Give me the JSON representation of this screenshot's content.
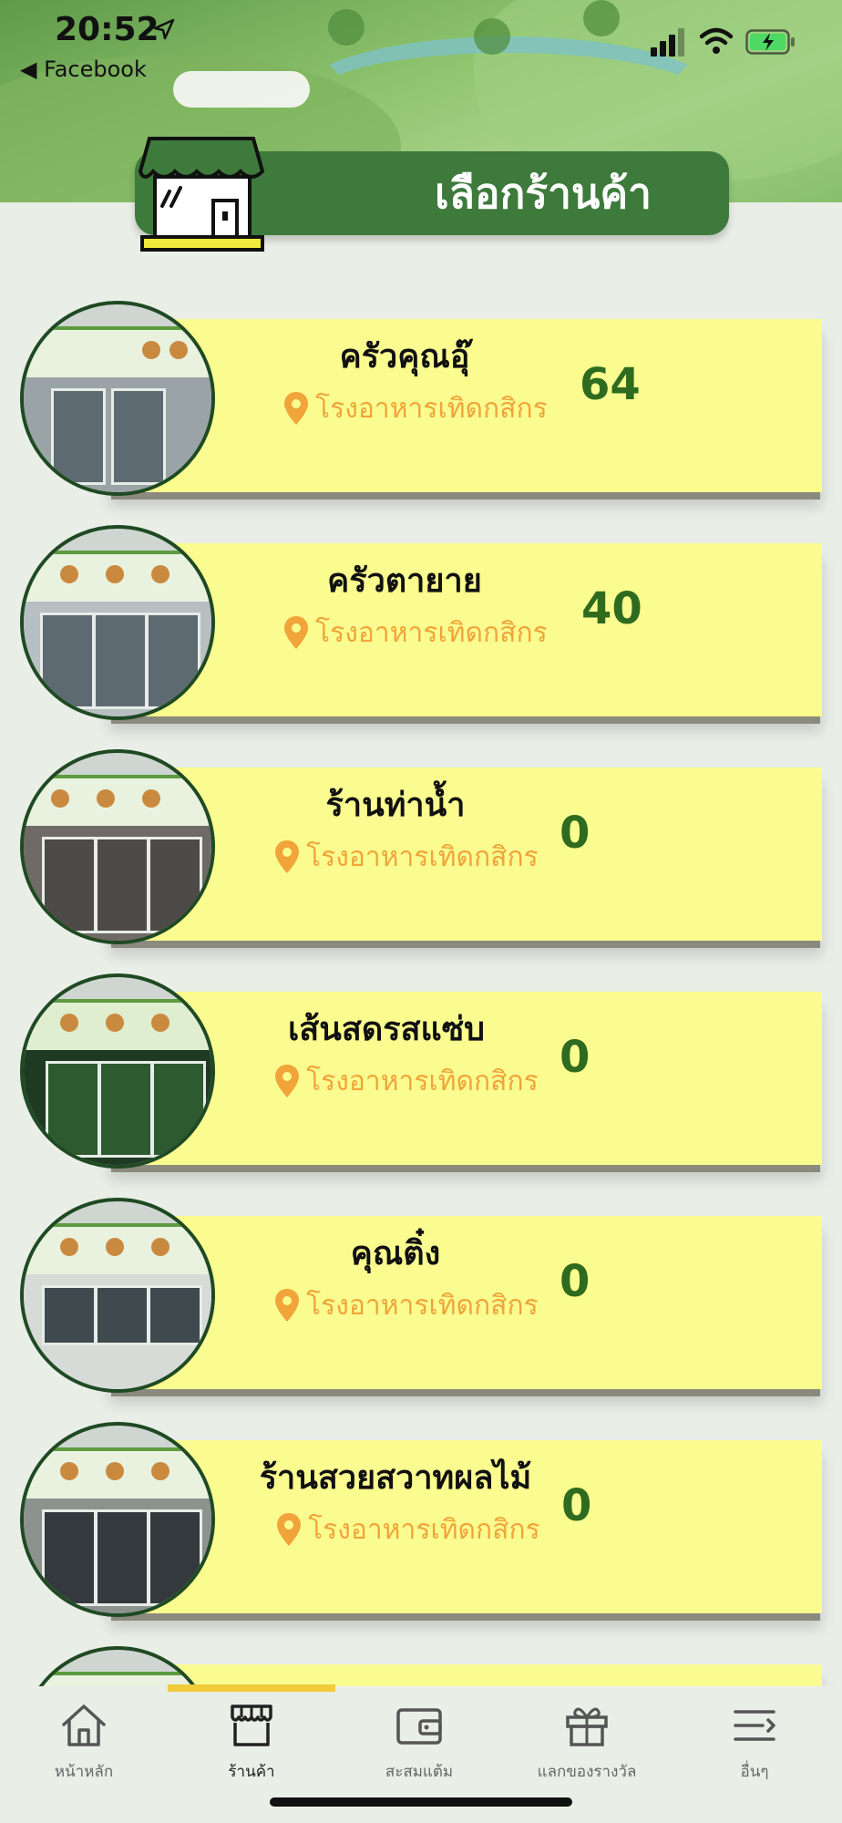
{
  "status_bar": {
    "time": "20:52",
    "back_label": "◀ Facebook"
  },
  "header": {
    "title": "เลือกร้านค้า"
  },
  "shops": [
    {
      "name": "ครัวคุณอุ๊",
      "location": "โรงอาหารเทิดกสิกร",
      "points": "64"
    },
    {
      "name": "ครัวตายาย",
      "location": "โรงอาหารเทิดกสิกร",
      "points": "40"
    },
    {
      "name": "ร้านท่าน้ำ",
      "location": "โรงอาหารเทิดกสิกร",
      "points": "0"
    },
    {
      "name": "เส้นสดรสแซ่บ",
      "location": "โรงอาหารเทิดกสิกร",
      "points": "0"
    },
    {
      "name": "คุณติ๋ง",
      "location": "โรงอาหารเทิดกสิกร",
      "points": "0"
    },
    {
      "name": "ร้านสวยสวาทผลไม้",
      "location": "โรงอาหารเทิดกสิกร",
      "points": "0"
    }
  ],
  "tabbar": {
    "items": [
      {
        "label": "หน้าหลัก",
        "icon": "home-icon"
      },
      {
        "label": "ร้านค้า",
        "icon": "store-icon",
        "active": true
      },
      {
        "label": "สะสมแต้ม",
        "icon": "wallet-icon"
      },
      {
        "label": "แลกของรางวัล",
        "icon": "gift-icon"
      },
      {
        "label": "อื่นๆ",
        "icon": "menu-icon"
      }
    ]
  },
  "colors": {
    "accent_green": "#3d7a3b",
    "card_yellow": "#fbfc8f",
    "location_orange": "#f0a43a",
    "points_green": "#2f6b1f",
    "tab_indicator": "#f1cb3b"
  }
}
